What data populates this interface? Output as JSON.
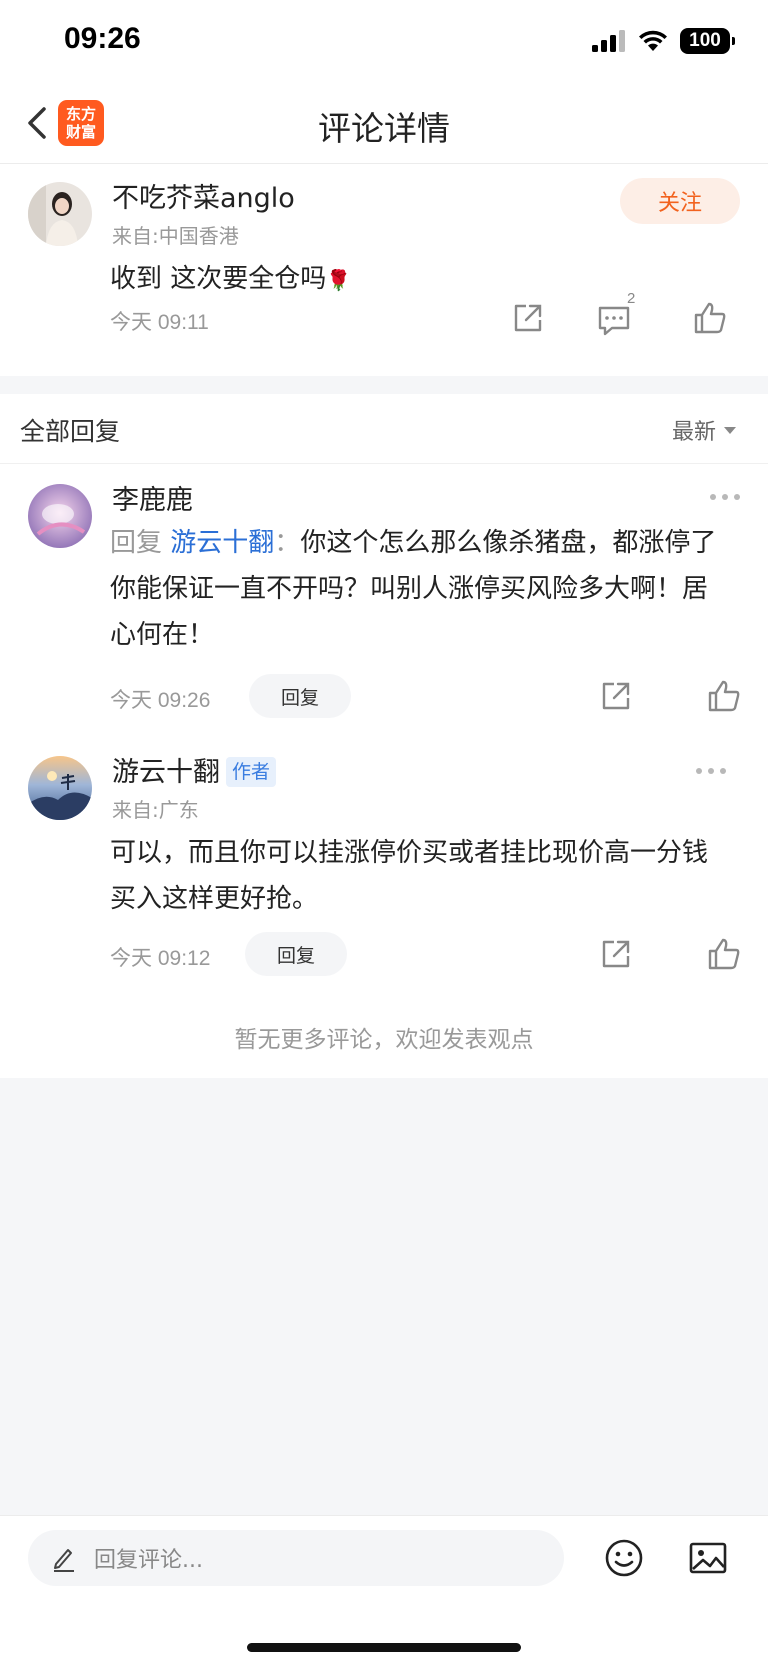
{
  "status_bar": {
    "time": "09:26",
    "battery": "100"
  },
  "nav": {
    "title": "评论详情",
    "brand_line1": "东方",
    "brand_line2": "财富"
  },
  "main_comment": {
    "username": "不吃芥菜anglo",
    "location": "来自:中国香港",
    "follow_label": "关注",
    "text": "收到 这次要全仓吗",
    "emoji": "🌹",
    "timestamp": "今天 09:11",
    "comment_count": "2"
  },
  "replies": {
    "header": "全部回复",
    "sort_label": "最新",
    "reply_button_label": "回复",
    "items": [
      {
        "username": "李鹿鹿",
        "reply_prefix": "回复",
        "reply_to": "游云十翻",
        "separator": "：",
        "text": "你这个怎么那么像杀猪盘，都涨停了 你能保证一直不开吗？叫别人涨停买风险多大啊！居心何在！",
        "timestamp": "今天 09:26"
      },
      {
        "username": "游云十翻",
        "badge": "作者",
        "location": "来自:广东",
        "text": "可以，而且你可以挂涨停价买或者挂比现价高一分钱买入这样更好抢。",
        "timestamp": "今天 09:12"
      }
    ],
    "end_note": "暂无更多评论，欢迎发表观点"
  },
  "bottom_bar": {
    "placeholder": "回复评论..."
  },
  "colors": {
    "accent": "#f2621e",
    "link": "#2b6fd6",
    "brand": "#ff5a1f"
  }
}
